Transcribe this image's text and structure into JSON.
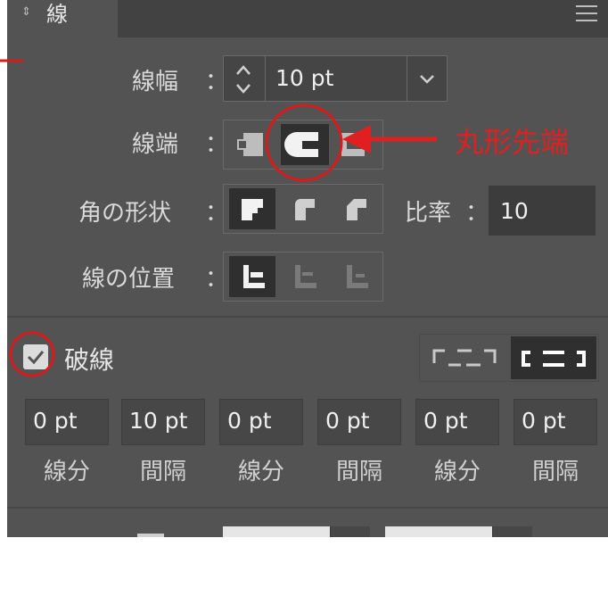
{
  "colors": {
    "panel_bg": "#535353",
    "annotation": "#e02020",
    "selected": "#2f2f2f"
  },
  "panel": {
    "title": "線",
    "collapse_icon": "updown-icon",
    "menu_icon": "hamburger-icon"
  },
  "stroke_weight": {
    "label": "線幅",
    "colon": "：",
    "value": "10 pt"
  },
  "cap": {
    "label": "線端",
    "colon": "：",
    "options": [
      "butt-cap-icon",
      "round-cap-icon",
      "projecting-cap-icon"
    ],
    "selected": "round-cap-icon"
  },
  "corner": {
    "label": "角の形状",
    "colon": "：",
    "options": [
      "miter-join-icon",
      "round-join-icon",
      "bevel-join-icon"
    ],
    "selected": "miter-join-icon"
  },
  "limit": {
    "label": "比率",
    "colon": "：",
    "value": "10"
  },
  "align": {
    "label": "線の位置",
    "colon": "：",
    "options": [
      "align-center-icon",
      "align-inside-icon",
      "align-outside-icon"
    ],
    "selected": "align-center-icon"
  },
  "dashed": {
    "checked": true,
    "label": "破線",
    "values": [
      "0 pt",
      "10 pt",
      "0 pt",
      "0 pt",
      "0 pt",
      "0 pt"
    ],
    "labels": [
      "線分",
      "間隔",
      "線分",
      "間隔",
      "線分",
      "間隔"
    ]
  },
  "annotation": {
    "text": "丸形先端"
  }
}
